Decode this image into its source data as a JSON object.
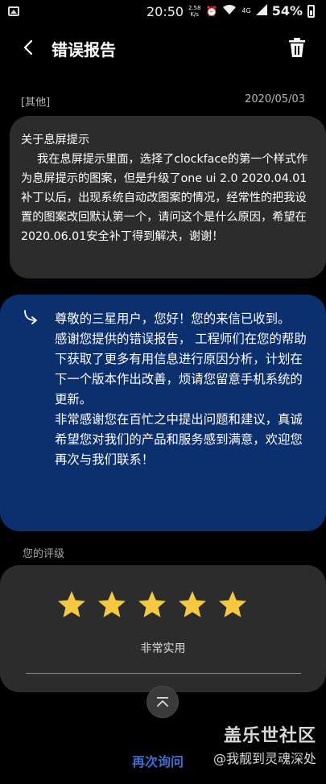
{
  "status_bar": {
    "time": "20:50",
    "speed_value": "2.58",
    "speed_unit": "K/s",
    "network": "4G",
    "battery_percent": "54%"
  },
  "header": {
    "title": "错误报告"
  },
  "report": {
    "category": "[其他]",
    "date": "2020/05/03",
    "title": "关于息屏提示",
    "body": "我在息屏提示里面，选择了clockface的第一个样式作为息屏提示的图案，但是升级了one ui 2.0 2020.04.01补丁以后，出现系统自动改图案的情况，经常性的把我设置的图案改回默认第一个，请问这个是什么原因，希望在2020.06.01安全补丁得到解决，谢谢！"
  },
  "reply": {
    "paragraphs": [
      "尊敬的三星用户，您好！您的来信已收到。",
      "感谢您提供的错误报告， 工程师们在您的帮助下获取了更多有用信息进行原因分析，计划在下一个版本作出改善，烦请您留意手机系统的更新。",
      "非常感谢您在百忙之中提出问题和建议，真诚希望您对我们的产品和服务感到满意，欢迎您再次与我们联系！"
    ]
  },
  "rating": {
    "label": "您的评级",
    "stars": 5,
    "max_stars": 5,
    "text": "非常实用",
    "star_color": "#f5c842"
  },
  "footer": {
    "requery_label": "再次询问",
    "watermark_site": "盖乐世社区",
    "watermark_user": "@我靓到灵魂深处"
  },
  "colors": {
    "background": "#000000",
    "card": "#2c2c2c",
    "reply_card": "#0c2f6e",
    "link": "#3a6fd6"
  }
}
